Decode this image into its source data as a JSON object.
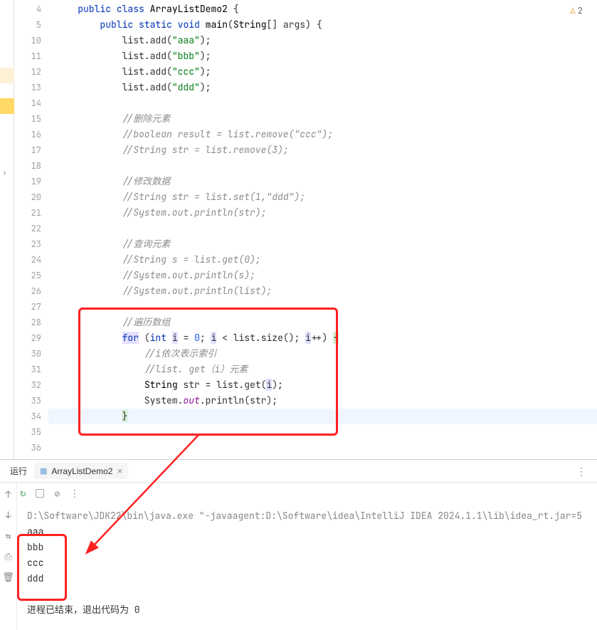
{
  "warning_count": "2",
  "lines": [
    {
      "n": "4",
      "html": "    <span class='kw'>public</span> <span class='kw'>class</span> <span class='cls'>ArrayListDemo2</span> {"
    },
    {
      "n": "5",
      "html": "        <span class='kw'>public</span> <span class='kw'>static</span> <span class='kw'>void</span> <span class='method'>main</span>(<span class='cls'>String</span>[] args) {"
    },
    {
      "n": "10",
      "html": "            list.add(<span class='str'>\"aaa\"</span>);"
    },
    {
      "n": "11",
      "html": "            list.add(<span class='str'>\"bbb\"</span>);"
    },
    {
      "n": "12",
      "html": "            list.add(<span class='str'>\"ccc\"</span>);"
    },
    {
      "n": "13",
      "html": "            list.add(<span class='str'>\"ddd\"</span>);"
    },
    {
      "n": "14",
      "html": ""
    },
    {
      "n": "15",
      "html": "            <span class='comment'>//删除元素</span>"
    },
    {
      "n": "16",
      "html": "            <span class='comment'>//boolean result = list.remove(\"ccc\");</span>"
    },
    {
      "n": "17",
      "html": "            <span class='comment'>//String str = list.remove(3);</span>"
    },
    {
      "n": "18",
      "html": ""
    },
    {
      "n": "19",
      "html": "            <span class='comment'>//修改数据</span>"
    },
    {
      "n": "20",
      "html": "            <span class='comment'>//String str = list.set(1,\"ddd\");</span>"
    },
    {
      "n": "21",
      "html": "            <span class='comment'>//System.out.println(str);</span>"
    },
    {
      "n": "22",
      "html": ""
    },
    {
      "n": "23",
      "html": "            <span class='comment'>//查询元素</span>"
    },
    {
      "n": "24",
      "html": "            <span class='comment'>//String s = list.get(0);</span>"
    },
    {
      "n": "25",
      "html": "            <span class='comment'>//System.out.println(s);</span>"
    },
    {
      "n": "26",
      "html": "            <span class='comment'>//System.out.println(list);</span>"
    },
    {
      "n": "27",
      "html": ""
    },
    {
      "n": "28",
      "html": "            <span class='comment'>//遍历数组</span>"
    },
    {
      "n": "29",
      "html": "            <span class='hl-for'><span class='kw'>for</span></span> (<span class='kw'>int</span> <span class='hl-i'>i</span> = <span class='num'>0</span>; <span class='hl-i'>i</span> &lt; list.size(); <span class='hl-i'>i</span>++) <span class='hl-brace'>{</span>"
    },
    {
      "n": "30",
      "html": "                <span class='comment'>//i依次表示索引</span>"
    },
    {
      "n": "31",
      "html": "                <span class='comment'>//list. get（i）元素</span>"
    },
    {
      "n": "32",
      "html": "                <span class='cls'>String</span> str = list.get(<span class='hl-i'>i</span>);"
    },
    {
      "n": "33",
      "html": "                System.<span class='field'>out</span>.println(str);"
    },
    {
      "n": "34",
      "html": "            <span class='hl-brace'>}</span>",
      "hl": true
    },
    {
      "n": "35",
      "html": ""
    },
    {
      "n": "36",
      "html": ""
    }
  ],
  "run": {
    "label": "运行",
    "tab_name": "ArrayListDemo2",
    "cmd": "D:\\Software\\JDK22\\bin\\java.exe \"-javaagent:D:\\Software\\idea\\IntelliJ IDEA 2024.1.1\\lib\\idea_rt.jar=5",
    "output": [
      "aaa",
      "bbb",
      "ccc",
      "ddd"
    ],
    "exit": "进程已结束，退出代码为 0"
  }
}
